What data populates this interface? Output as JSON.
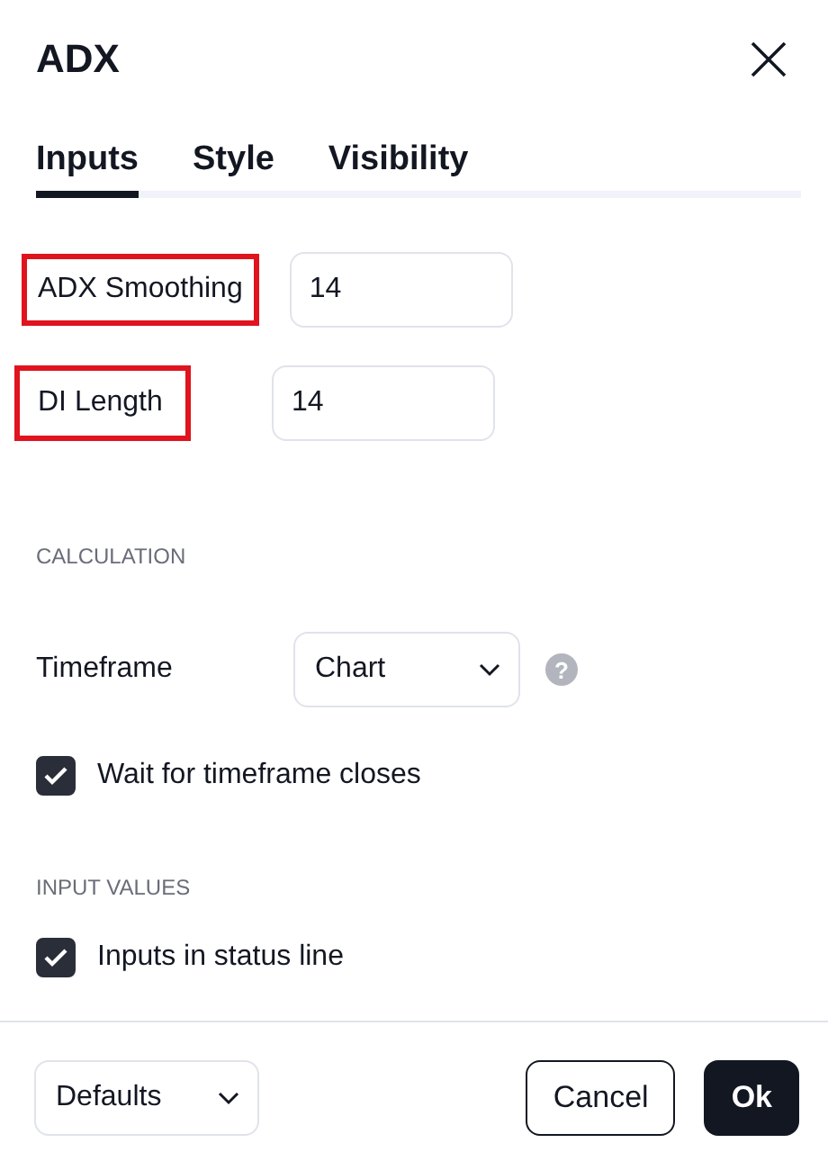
{
  "dialog": {
    "title": "ADX"
  },
  "tabs": [
    {
      "label": "Inputs",
      "selected": true
    },
    {
      "label": "Style",
      "selected": false
    },
    {
      "label": "Visibility",
      "selected": false
    }
  ],
  "inputs": [
    {
      "label": "ADX Smoothing",
      "value": "14",
      "highlighted": true
    },
    {
      "label": "DI Length",
      "value": "14",
      "highlighted": true
    }
  ],
  "sections": [
    {
      "heading": "CALCULATION",
      "items": [
        {
          "kind": "select",
          "label": "Timeframe",
          "value": "Chart",
          "help": "?"
        },
        {
          "kind": "checkbox",
          "label": "Wait for timeframe closes",
          "checked": true
        }
      ]
    },
    {
      "heading": "INPUT VALUES",
      "items": [
        {
          "kind": "checkbox",
          "label": "Inputs in status line",
          "checked": true
        }
      ]
    }
  ],
  "footer": {
    "preset": "Defaults",
    "buttons": [
      {
        "label": "Cancel",
        "kind": "secondary"
      },
      {
        "label": "Ok",
        "kind": "primary"
      }
    ]
  }
}
